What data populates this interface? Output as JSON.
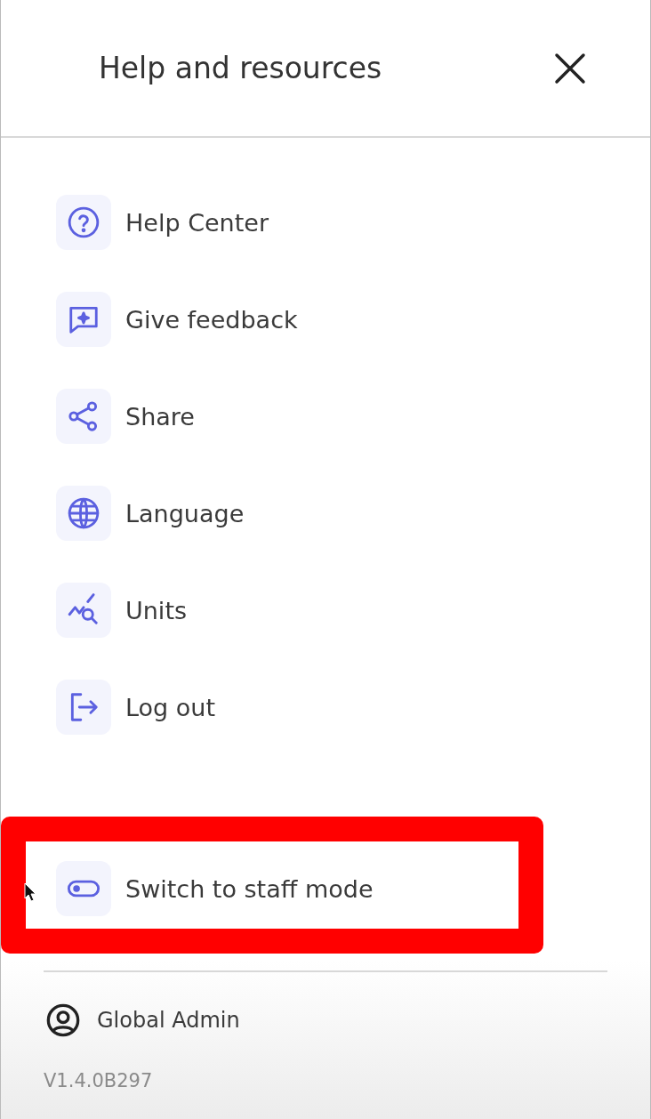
{
  "header": {
    "title": "Help and resources"
  },
  "menu": [
    {
      "kind": "help",
      "label": "Help Center"
    },
    {
      "kind": "feedback",
      "label": "Give feedback"
    },
    {
      "kind": "share",
      "label": "Share"
    },
    {
      "kind": "language",
      "label": "Language"
    },
    {
      "kind": "units",
      "label": "Units"
    },
    {
      "kind": "logout",
      "label": "Log out"
    }
  ],
  "staff_item": {
    "kind": "toggle",
    "label": "Switch to staff mode"
  },
  "footer": {
    "user": "Global Admin",
    "version": "V1.4.0B297"
  }
}
